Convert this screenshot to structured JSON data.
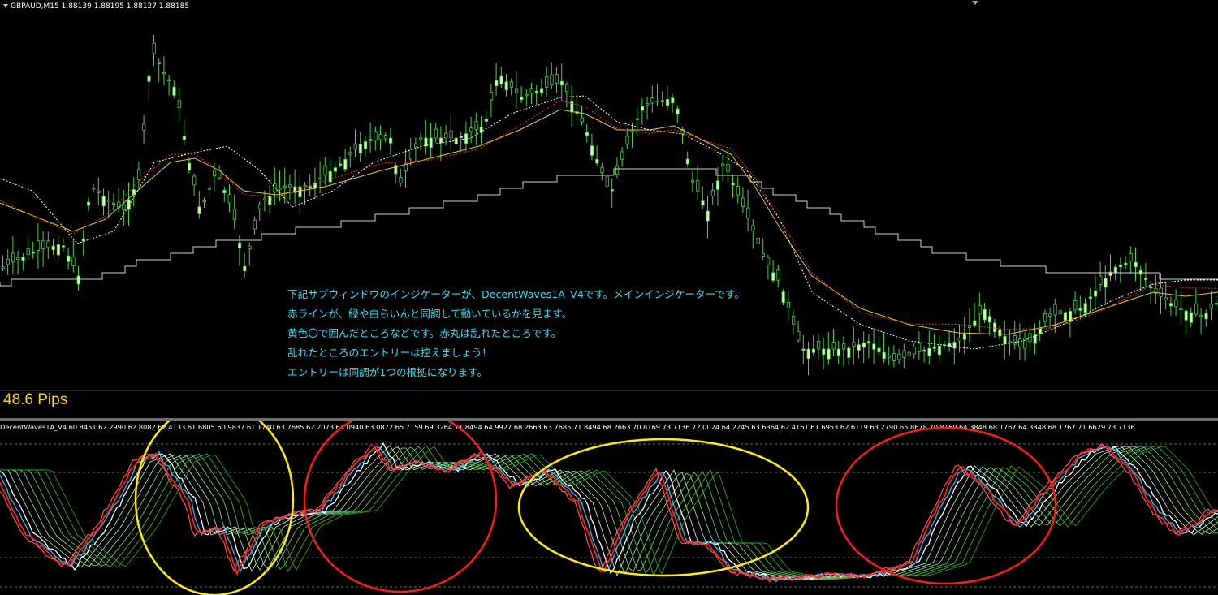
{
  "main_chart": {
    "header": "GBPAUD,M15  1.88139 1.88195 1.88127 1.88185",
    "pips_label": "48.6 Pips",
    "annotation_lines": [
      "下記サブウィンドウのインジケーターが、DecentWaves1A_V4です。メインインジケーターです。",
      "赤ラインが、緑や白らいんと同調して動いているかを見ます。",
      "黄色〇で囲んだところなどです。赤丸は乱れたところです。",
      "乱れたところのエントリーは控えましょう！",
      "エントリーは同調が1つの根拠になります。"
    ],
    "colors": {
      "candle": "#3ed84b",
      "candle_body": "#d9ffb0",
      "annotation": "#2fe0f5",
      "pips": "#ffd700"
    }
  },
  "sub_chart": {
    "header": "DecentWaves1A_V4 60.8451 62.2990 62.8082 62.4133 61.6805 60.9837 61.1740 63.7685 62.2073 64.0940 63.0872 65.7159 69.3264 71.8494 64.9927 68.2663 63.7685 71.8494 68.2663 70.8169 73.7136 72.0024 64.2245 63.6364 62.4161 61.6953 62.6119 63.2790 65.8678 70.8169 64.3848 68.1767 64.3848 68.1767 71.6629 73.7136",
    "highlight_ellipses": [
      {
        "label": "synchronized",
        "color": "#ffee00"
      },
      {
        "label": "disordered",
        "color": "#ff1a1a"
      },
      {
        "label": "synchronized",
        "color": "#ffee00"
      },
      {
        "label": "disordered",
        "color": "#ff1a1a"
      }
    ]
  }
}
